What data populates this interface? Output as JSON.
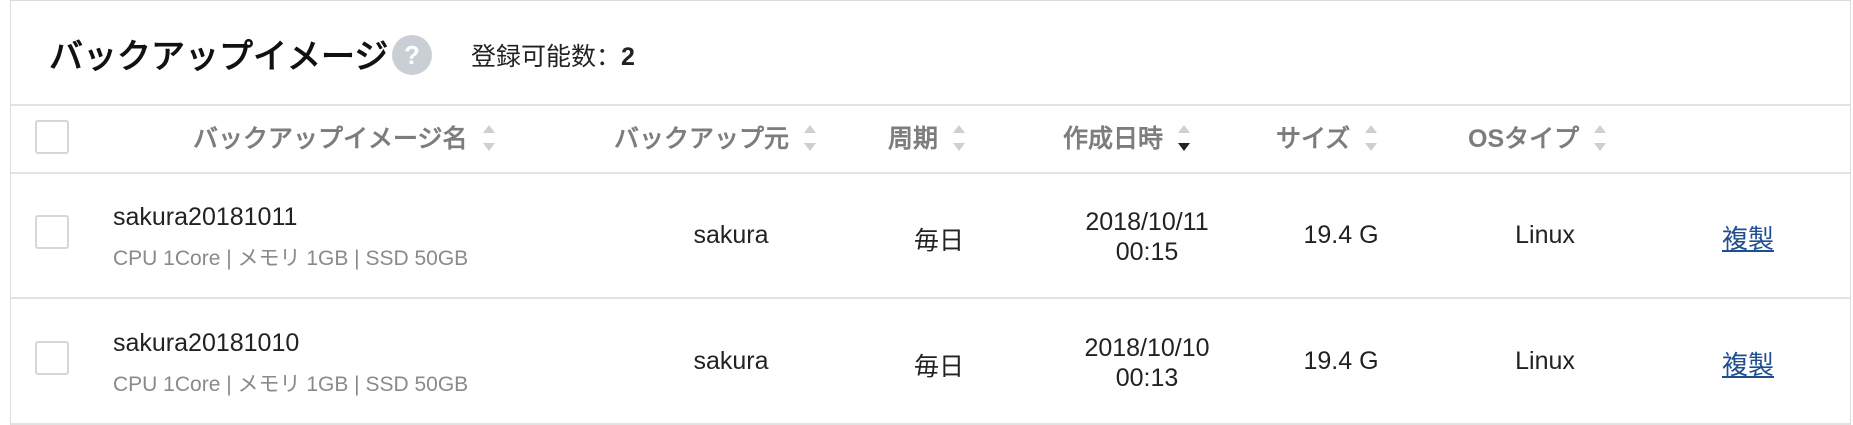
{
  "header": {
    "title": "バックアップイメージ",
    "help_symbol": "?",
    "count_label": "登録可能数：",
    "count_value": "2"
  },
  "columns": [
    {
      "label": "バックアップイメージ名",
      "sort": "none"
    },
    {
      "label": "バックアップ元",
      "sort": "none"
    },
    {
      "label": "周期",
      "sort": "none"
    },
    {
      "label": "作成日時",
      "sort": "desc"
    },
    {
      "label": "サイズ",
      "sort": "none"
    },
    {
      "label": "OSタイプ",
      "sort": "none"
    }
  ],
  "rows": [
    {
      "name": "sakura20181011",
      "spec": "CPU 1Core | メモリ 1GB | SSD 50GB",
      "source": "sakura",
      "cycle": "毎日",
      "date": "2018/10/11",
      "time": "00:15",
      "size": "19.4 G",
      "os": "Linux",
      "action": "複製"
    },
    {
      "name": "sakura20181010",
      "spec": "CPU 1Core | メモリ 1GB | SSD 50GB",
      "source": "sakura",
      "cycle": "毎日",
      "date": "2018/10/10",
      "time": "00:13",
      "size": "19.4 G",
      "os": "Linux",
      "action": "複製"
    }
  ],
  "colors": {
    "link": "#1d4e8f",
    "header_text": "#7d7d7d",
    "help_bg": "#c9cfd5"
  }
}
